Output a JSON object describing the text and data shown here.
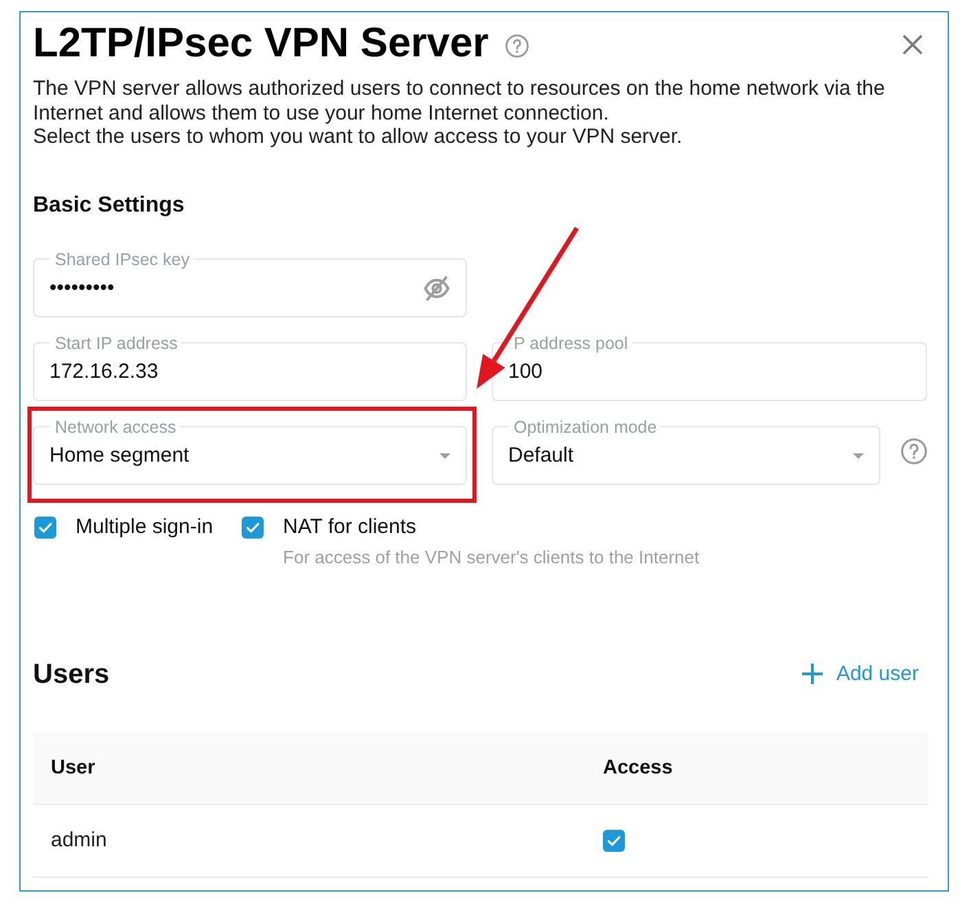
{
  "dialog": {
    "title": "L2TP/IPsec VPN Server",
    "description": [
      "The VPN server allows authorized users to connect to resources on the home network via the Internet and allows them to use your home Internet connection.",
      "Select the users to whom you want to allow access to your VPN server."
    ]
  },
  "basic_settings": {
    "heading": "Basic Settings",
    "rows": [
      [
        {
          "kind": "password",
          "label": "Shared IPsec key",
          "value": "•••••••••",
          "highlighted": false,
          "help": false
        }
      ],
      [
        {
          "kind": "text",
          "label": "Start IP address",
          "value": "172.16.2.33",
          "highlighted": false,
          "help": false
        },
        {
          "kind": "text",
          "label": "P address pool",
          "value": "100",
          "highlighted": false,
          "help": false
        }
      ],
      [
        {
          "kind": "select",
          "label": "Network access",
          "value": "Home segment",
          "highlighted": true,
          "help": false
        },
        {
          "kind": "select",
          "label": "Optimization mode",
          "value": "Default",
          "highlighted": false,
          "help": true
        }
      ]
    ],
    "options": [
      {
        "label": "Multiple sign-in",
        "checked": true
      },
      {
        "label": "NAT for clients",
        "checked": true,
        "hint": "For access of the VPN server's clients to the Internet"
      }
    ]
  },
  "users": {
    "heading": "Users",
    "add_button": "Add user",
    "columns": [
      "User",
      "Access"
    ],
    "rows": [
      {
        "user": "admin",
        "access": true
      }
    ]
  },
  "annotations": [
    {
      "kind": "arrow"
    }
  ]
}
